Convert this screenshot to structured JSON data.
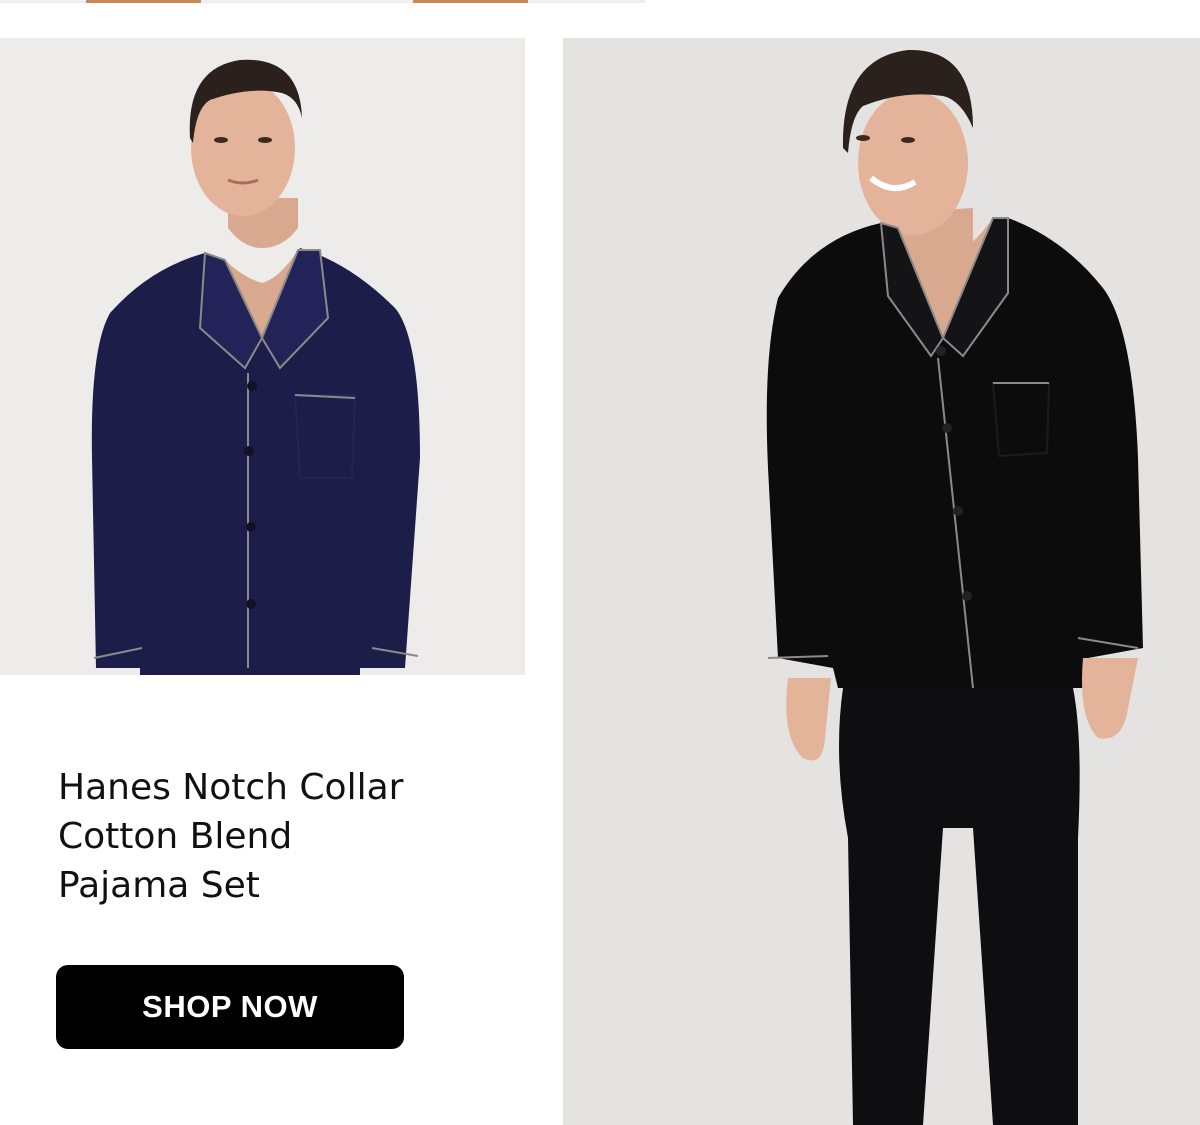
{
  "colors": {
    "left_photo_bg": "#eeebeb",
    "right_photo_bg": "#e5e2e2",
    "navy_pajama": "#1d1d4a",
    "black_pajama": "#0c0c0d",
    "piping": "#8a8a8a",
    "button_bg": "#000000",
    "button_text": "#ffffff",
    "accent": "#c98a5a"
  },
  "product": {
    "title_lines": [
      "Hanes Notch Collar",
      "Cotton Blend",
      "Pajama Set"
    ],
    "images": [
      {
        "name": "navy-pajama-photo",
        "color": "navy"
      },
      {
        "name": "black-pajama-photo",
        "color": "black"
      }
    ]
  },
  "cta": {
    "label": "SHOP NOW"
  }
}
